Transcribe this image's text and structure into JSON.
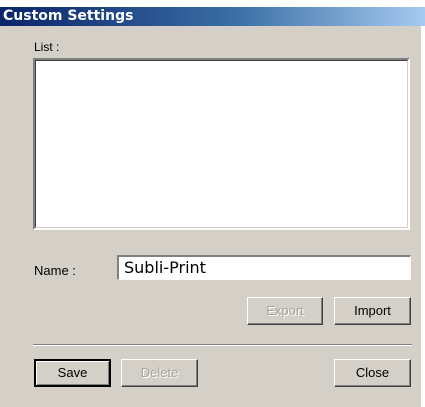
{
  "window": {
    "title": "Custom Settings"
  },
  "list": {
    "label": "List :",
    "items": []
  },
  "name": {
    "label": "Name :",
    "value": "Subli-Print"
  },
  "buttons": {
    "export": "Export",
    "import": "Import",
    "save": "Save",
    "delete": "Delete",
    "close": "Close"
  }
}
